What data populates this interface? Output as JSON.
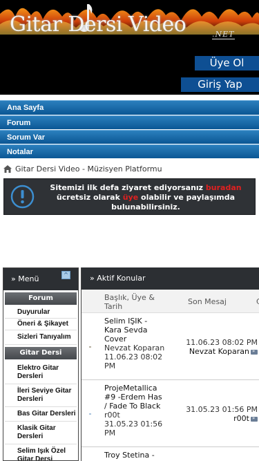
{
  "site": {
    "logo_text": "Gitar Dersi Video",
    "logo_suffix": ".NET",
    "register_label": "Üye Ol",
    "login_label": "Giriş Yap"
  },
  "nav": {
    "items": [
      {
        "label": "Ana Sayfa"
      },
      {
        "label": "Forum"
      },
      {
        "label": "Sorum Var"
      },
      {
        "label": "Notalar"
      }
    ]
  },
  "breadcrumb": {
    "text": "Gitar Dersi Video - Müzisyen Platformu"
  },
  "notice": {
    "part1": "Sitemizi ilk defa ziyaret ediyorsanız ",
    "link1": "buradan",
    "part2": " ücretsiz olarak ",
    "link2": "üye",
    "part3": " olabilir ve paylaşımda bulunabilirsiniz."
  },
  "sidebar": {
    "title": "» Menü",
    "collapse_symbol": "^",
    "sections": [
      {
        "title": "Forum",
        "links": [
          "Duyurular",
          "Öneri & Şikayet",
          "Sizleri Tanıyalım"
        ]
      },
      {
        "title": "Gitar Dersi",
        "links": [
          "Elektro Gitar Dersleri",
          "İleri Seviye Gitar Dersleri",
          "Bas Gitar Dersleri",
          "Klasik Gitar Dersleri",
          "Selim Işık Özel Gitar Dersi"
        ]
      }
    ]
  },
  "topics": {
    "title": "» Aktif Konular",
    "col_title": "Başlık, Üye & Tarih",
    "col_last": "Son Mesaj",
    "col_extra": "C",
    "rows": [
      {
        "title": "Selim IŞIK - Kara Sevda Cover",
        "author": "Nevzat Koparan",
        "date": "11.06.23 08:02 PM",
        "last_date": "11.06.23 08:02 PM",
        "last_user": "Nevzat Koparan"
      },
      {
        "title": "ProjeMetallica #9 -Erdem Has / Fade To Black",
        "author": "r00t",
        "date": "31.05.23 01:56 PM",
        "last_date": "31.05.23 01:56 PM",
        "last_user": "r00t"
      },
      {
        "title": "Troy Stetina -",
        "author": "",
        "date": "",
        "last_date": "",
        "last_user": ""
      }
    ]
  },
  "colors": {
    "nav_blue": "#0b5794",
    "button_blue": "#0e4f93",
    "notice_bg": "#2f3236",
    "notice_highlight": "#e02020",
    "panel_header": "#2c2f33"
  },
  "icons": [
    "home-icon",
    "alert-icon",
    "collapse-icon",
    "go-to-last-icon"
  ]
}
